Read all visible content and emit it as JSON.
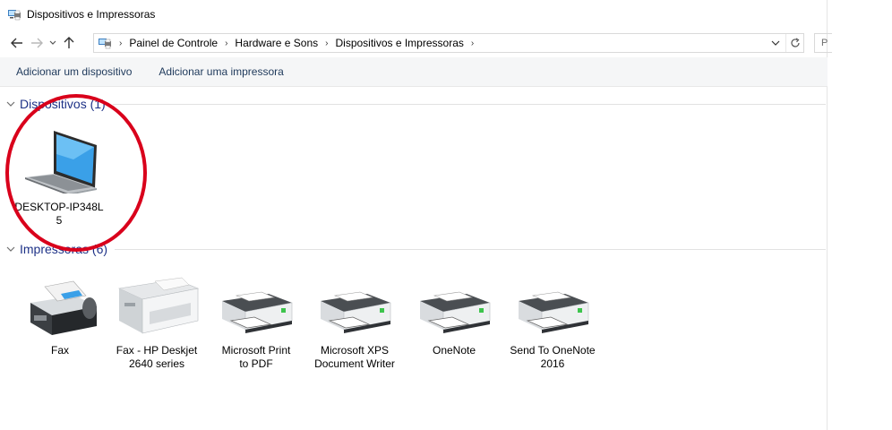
{
  "window": {
    "title": "Dispositivos e Impressoras"
  },
  "nav": {
    "breadcrumb": [
      "Painel de Controle",
      "Hardware e Sons",
      "Dispositivos e Impressoras"
    ],
    "search_placeholder": "P"
  },
  "commands": {
    "add_device": "Adicionar um dispositivo",
    "add_printer": "Adicionar uma impressora"
  },
  "groups": {
    "devices": {
      "label": "Dispositivos (1)",
      "items": [
        {
          "name_line1": "DESKTOP-IP348L",
          "name_line2": "5",
          "icon": "laptop-icon"
        }
      ]
    },
    "printers": {
      "label": "Impressoras (6)",
      "items": [
        {
          "name_line1": "Fax",
          "name_line2": "",
          "icon": "fax-icon"
        },
        {
          "name_line1": "Fax - HP Deskjet",
          "name_line2": "2640 series",
          "icon": "inkjet-printer-icon"
        },
        {
          "name_line1": "Microsoft Print",
          "name_line2": "to PDF",
          "icon": "printer-icon"
        },
        {
          "name_line1": "Microsoft XPS",
          "name_line2": "Document Writer",
          "icon": "printer-icon"
        },
        {
          "name_line1": "OneNote",
          "name_line2": "",
          "icon": "printer-icon"
        },
        {
          "name_line1": "Send To OneNote",
          "name_line2": "2016",
          "icon": "printer-icon"
        }
      ]
    }
  },
  "colors": {
    "group_header": "#1e3287",
    "command_text": "#1e395b",
    "annotation_circle": "#d9001b"
  }
}
